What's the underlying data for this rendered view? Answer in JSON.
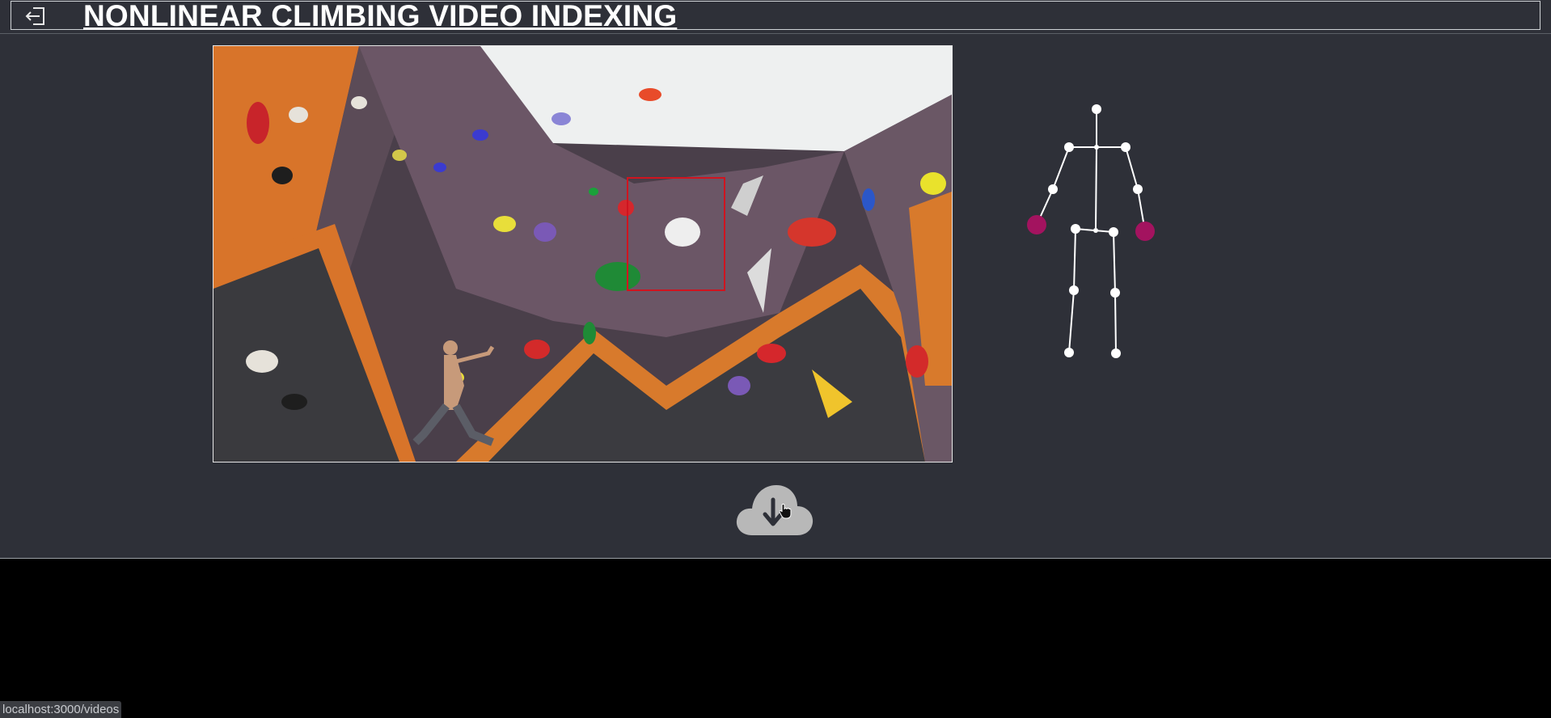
{
  "header": {
    "title": "NONLINEAR CLIMBING VIDEO INDEXING",
    "back_icon": "sign-out-arrow-icon"
  },
  "video": {
    "description_icon": "climbing-wall-frame",
    "highlight_color": "#d0141f"
  },
  "skeleton": {
    "line_color": "#ffffff",
    "highlight_color": "#a3135f",
    "highlighted_joints": [
      "left-hand",
      "right-hand"
    ]
  },
  "download": {
    "icon": "cloud-download-icon",
    "color": "#b8b8b8"
  },
  "status_bar": {
    "url": "localhost:3000/videos"
  }
}
